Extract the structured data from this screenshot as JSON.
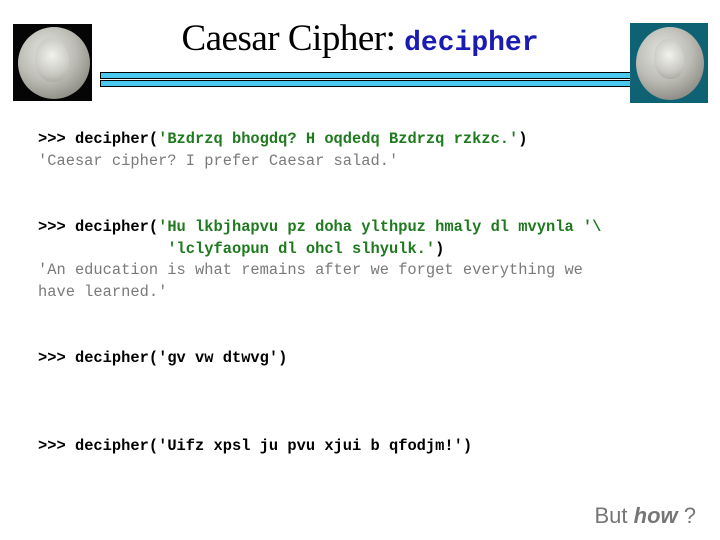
{
  "header": {
    "title_text": "Caesar Cipher: ",
    "title_code": "decipher",
    "left_image": "roman-coin-portrait-icon",
    "right_image": "caesar-coin-portrait-icon"
  },
  "examples": [
    {
      "prompt": ">>> ",
      "call_start": "decipher(",
      "arg_lines": [
        "'Bzdrzq bhogdq? H oqdedq Bzdrzq rzkzc.'"
      ],
      "call_end": ")",
      "output_lines": [
        "'Caesar cipher? I prefer Caesar salad.'"
      ]
    },
    {
      "prompt": ">>> ",
      "call_start": "decipher(",
      "arg_lines": [
        "'Hu lkbjhapvu pz doha ylthpuz hmaly dl mvynla '\\",
        "'lclyfaopun dl ohcl slhyulk.'"
      ],
      "call_end": ")",
      "continuation_indent": "              ",
      "output_lines": [
        "'An education is what remains after we forget everything we",
        "have learned.'"
      ]
    },
    {
      "prompt": ">>> ",
      "call_start": "decipher(",
      "arg_lines": [
        "'gv vw dtwvg'"
      ],
      "call_end": ")",
      "output_lines": []
    },
    {
      "prompt": ">>> ",
      "call_start": "decipher(",
      "arg_lines": [
        "'Uifz xpsl ju pvu xjui b qfodjm!'"
      ],
      "call_end": ")",
      "output_lines": []
    }
  ],
  "footer": {
    "before": "But ",
    "emphasis": "how",
    "after": " ?"
  }
}
